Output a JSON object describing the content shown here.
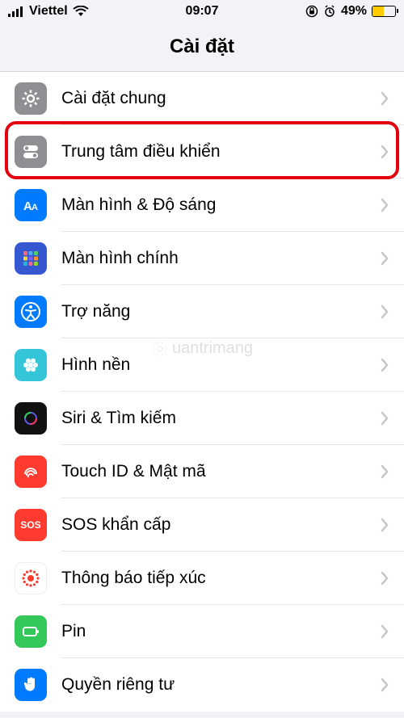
{
  "status_bar": {
    "carrier": "Viettel",
    "time": "09:07",
    "battery_percent": "49%",
    "battery_fill_color": "#ffcc00",
    "battery_fill_width": "49%"
  },
  "nav": {
    "title": "Cài đặt"
  },
  "highlight_index": 1,
  "rows": [
    {
      "id": "general",
      "label": "Cài đặt chung",
      "icon": "gear",
      "bg": "bg-gray"
    },
    {
      "id": "control-center",
      "label": "Trung tâm điều khiển",
      "icon": "switches",
      "bg": "bg-gray"
    },
    {
      "id": "display",
      "label": "Màn hình & Độ sáng",
      "icon": "text-size",
      "bg": "bg-blue"
    },
    {
      "id": "home-screen",
      "label": "Màn hình chính",
      "icon": "apps-grid",
      "bg": "bg-indigo"
    },
    {
      "id": "accessibility",
      "label": "Trợ năng",
      "icon": "accessibility",
      "bg": "bg-blue"
    },
    {
      "id": "wallpaper",
      "label": "Hình nền",
      "icon": "flower",
      "bg": "bg-cyan"
    },
    {
      "id": "siri",
      "label": "Siri & Tìm kiếm",
      "icon": "siri",
      "bg": "bg-black"
    },
    {
      "id": "touch-id",
      "label": "Touch ID & Mật mã",
      "icon": "fingerprint",
      "bg": "bg-red"
    },
    {
      "id": "sos",
      "label": "SOS khẩn cấp",
      "icon": "sos",
      "bg": "bg-red"
    },
    {
      "id": "exposure",
      "label": "Thông báo tiếp xúc",
      "icon": "exposure",
      "bg": "bg-white"
    },
    {
      "id": "battery",
      "label": "Pin",
      "icon": "battery",
      "bg": "bg-green"
    },
    {
      "id": "privacy",
      "label": "Quyền riêng tư",
      "icon": "hand",
      "bg": "bg-blue"
    }
  ],
  "watermark": "uantrimang"
}
